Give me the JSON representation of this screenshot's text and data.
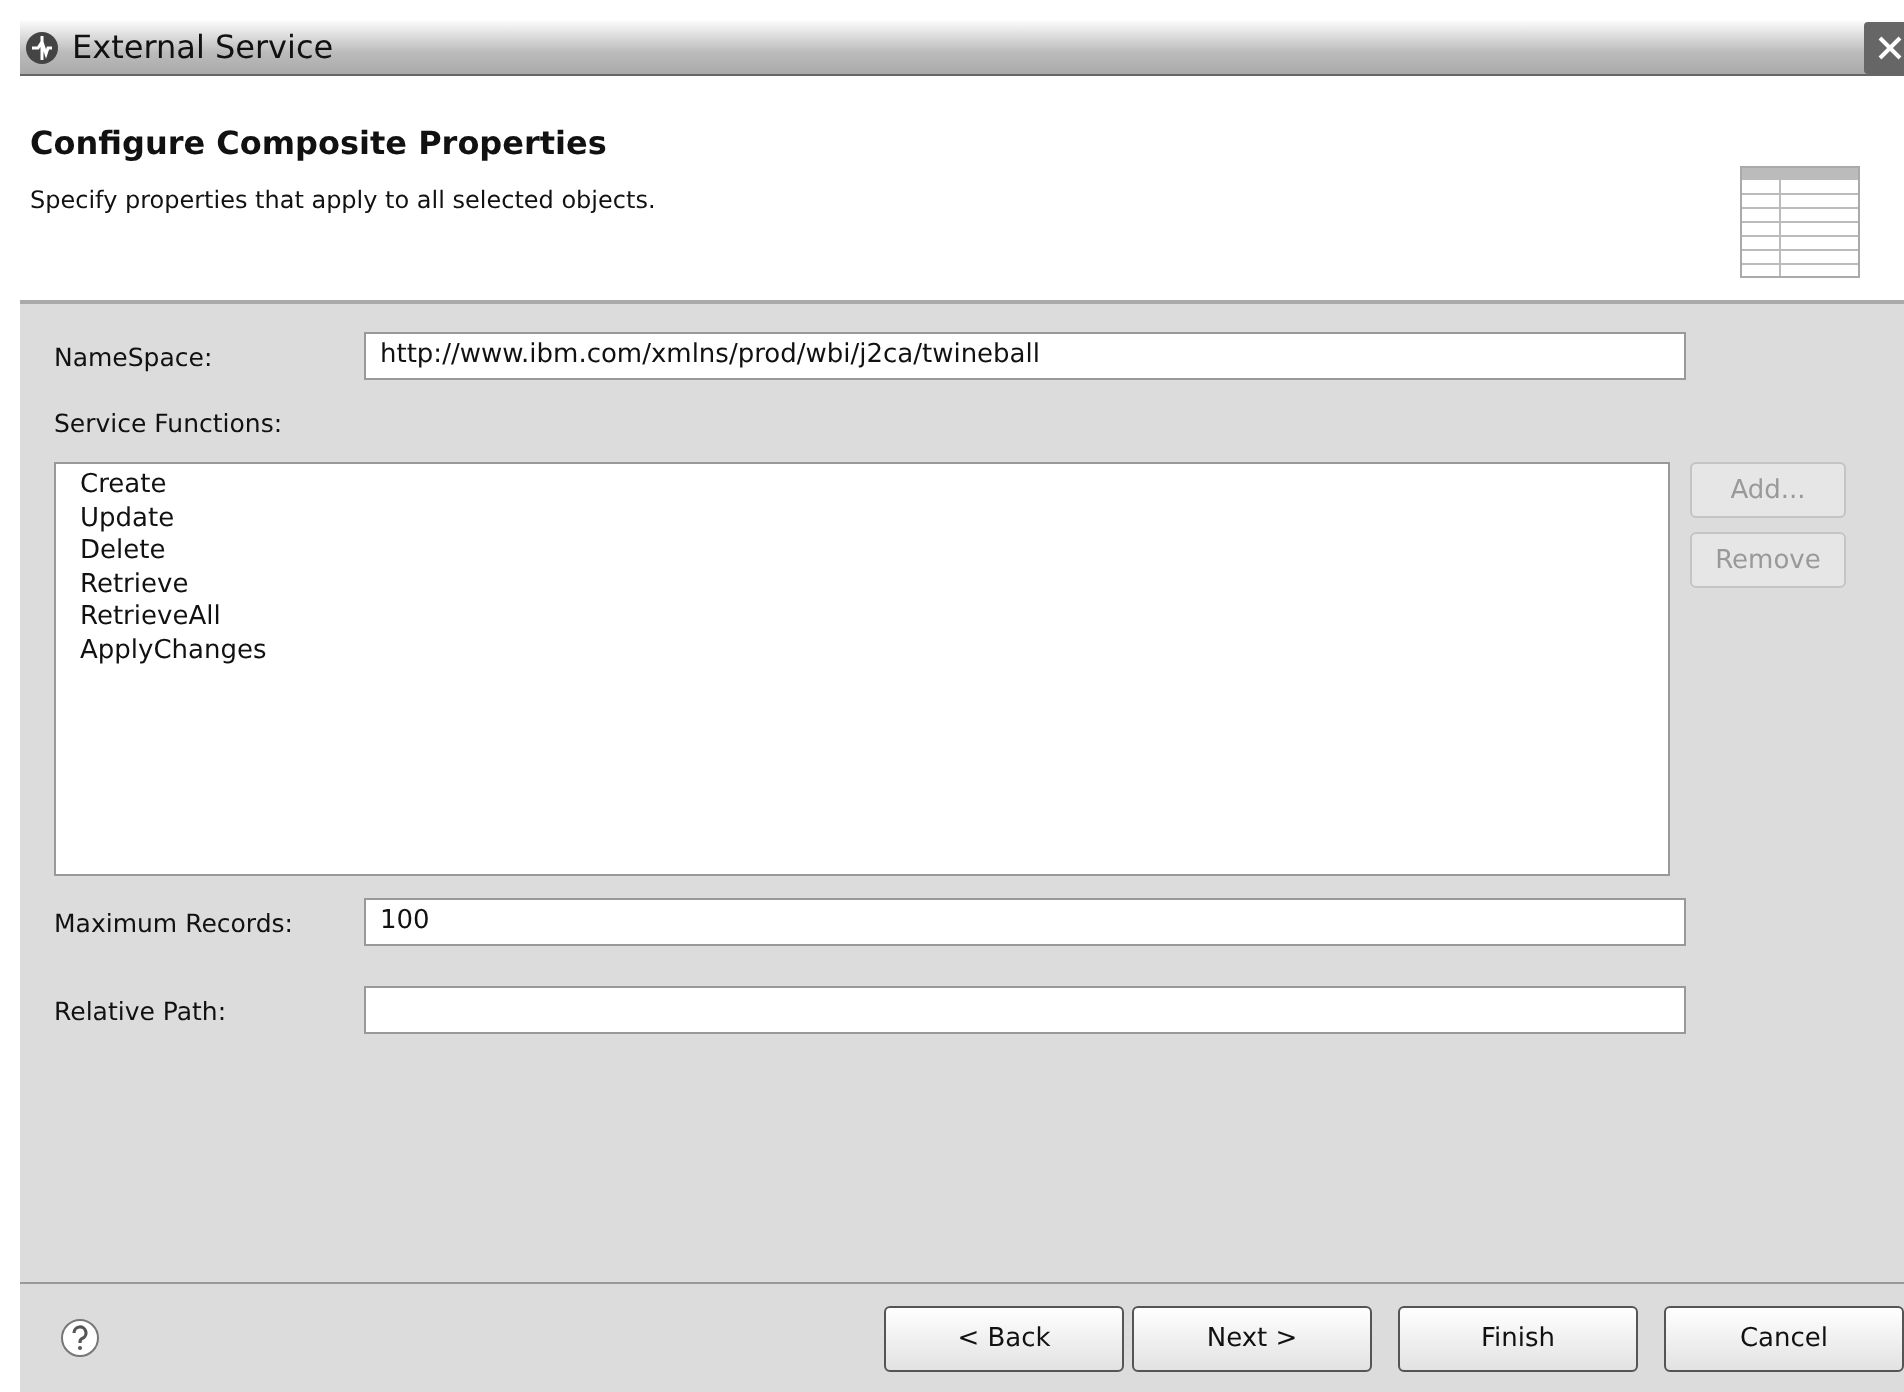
{
  "window": {
    "title": "External Service"
  },
  "header": {
    "title": "Configure Composite Properties",
    "description": "Specify properties that apply to all selected objects."
  },
  "namespace": {
    "label": "NameSpace:",
    "value": "http://www.ibm.com/xmlns/prod/wbi/j2ca/twineball"
  },
  "service_functions": {
    "label": "Service Functions:",
    "items": [
      "Create",
      "Update",
      "Delete",
      "Retrieve",
      "RetrieveAll",
      "ApplyChanges"
    ],
    "buttons": [
      {
        "label": "Add...",
        "disabled": true
      },
      {
        "label": "Remove",
        "disabled": true
      }
    ]
  },
  "maximum_records": {
    "label": "Maximum Records:",
    "value": "100"
  },
  "relative_path": {
    "label": "Relative Path:"
  },
  "footer_buttons": [
    {
      "label": "< Back",
      "disabled": false
    },
    {
      "label": "Next >",
      "disabled": false
    },
    {
      "label": "Finish",
      "disabled": false
    },
    {
      "label": "Cancel",
      "disabled": false
    }
  ]
}
